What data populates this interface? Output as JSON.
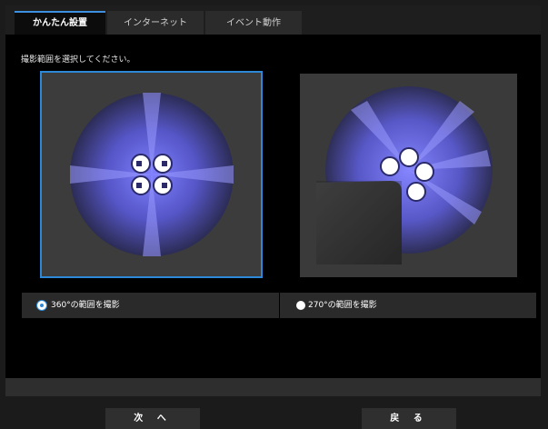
{
  "tabs": [
    {
      "label": "かんたん設置",
      "active": true
    },
    {
      "label": "インターネット",
      "active": false
    },
    {
      "label": "イベント動作",
      "active": false
    }
  ],
  "instruction": "撮影範囲を選択してください。",
  "options": [
    {
      "label": "360°の範囲を撮影",
      "selected": true
    },
    {
      "label": "270°の範囲を撮影",
      "selected": false
    }
  ],
  "buttons": {
    "next": "次 へ",
    "back": "戻 る"
  },
  "colors": {
    "accent": "#2e88d8",
    "coverage": "#7a7aff"
  },
  "icons": {
    "camera_lens": "camera-lens-icon"
  }
}
